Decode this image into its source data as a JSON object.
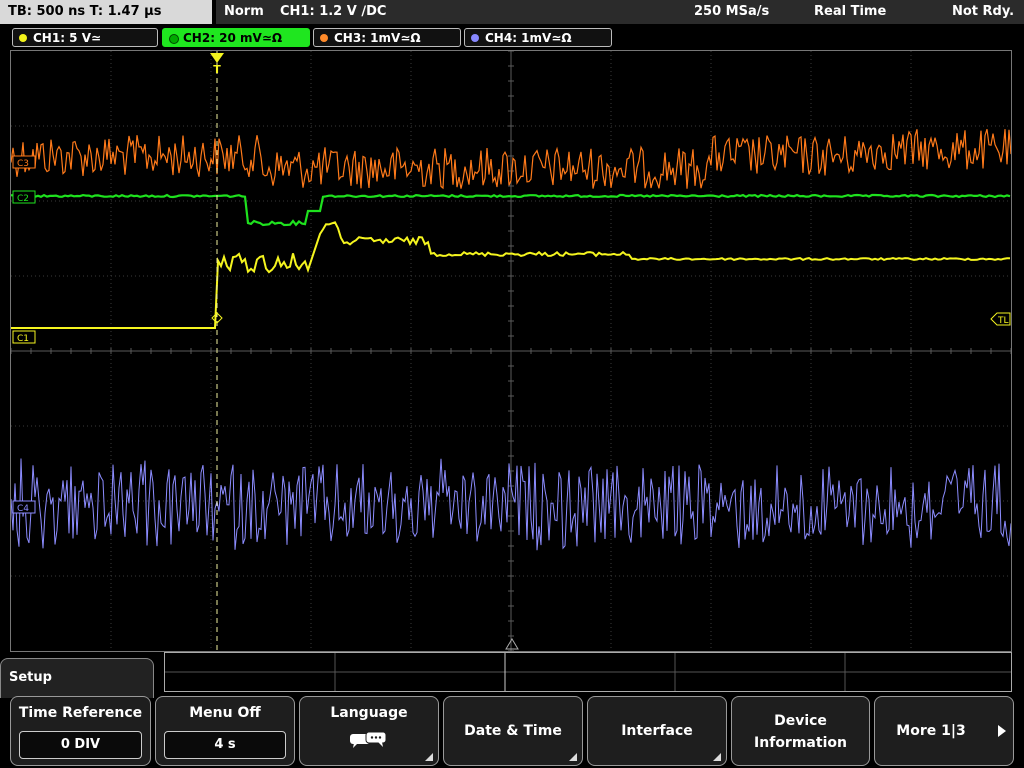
{
  "status": {
    "timebase": "TB: 500 ns   T: 1.47 µs",
    "mode": "Norm",
    "trigger": "CH1: 1.2 V ∕DC",
    "sample_rate": "250 MSa/s",
    "acq_mode": "Real Time",
    "state": "Not Rdy."
  },
  "channels": [
    {
      "label": "CH1: 5 V≃",
      "color": "#f2f21a"
    },
    {
      "label": "CH2: 20 mV≃Ω",
      "color": "#1fe61f"
    },
    {
      "label": "CH3: 1mV≃Ω",
      "color": "#ff8a2a"
    },
    {
      "label": "CH4: 1mV≃Ω",
      "color": "#8888ff"
    }
  ],
  "markers": {
    "c1": "C1",
    "c2": "C2",
    "c3": "C3",
    "c4": "C4",
    "tl": "TL",
    "trigger": "T"
  },
  "menu": {
    "title": "Setup",
    "softkeys": [
      {
        "label": "Time Reference",
        "value": "0 DIV"
      },
      {
        "label": "Menu Off",
        "value": "4 s"
      },
      {
        "label": "Language",
        "icon": "speech-bubbles-icon"
      },
      {
        "label": "Date & Time"
      },
      {
        "label": "Interface"
      },
      {
        "label": "Device",
        "label2": "Information"
      },
      {
        "label": "More 1|3",
        "icon": "play-arrow-icon"
      }
    ]
  }
}
